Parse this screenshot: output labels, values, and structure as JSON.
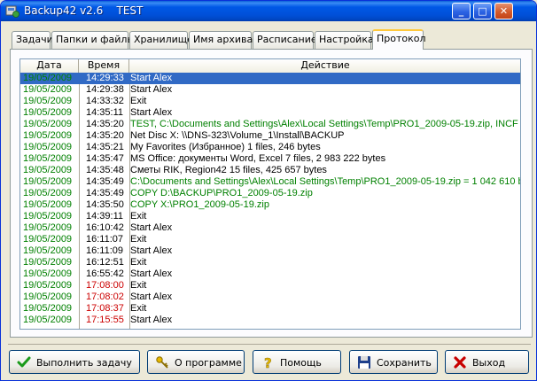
{
  "window": {
    "title": "Backup42 v2.6    TEST",
    "minimize": "_",
    "maximize": "□",
    "close": "✕"
  },
  "tabs": [
    {
      "label": "Задачи"
    },
    {
      "label": "Папки и файлы"
    },
    {
      "label": "Хранилище"
    },
    {
      "label": "Имя архива"
    },
    {
      "label": "Расписание"
    },
    {
      "label": "Настройка"
    },
    {
      "label": "Протокол"
    }
  ],
  "active_tab": "Протокол",
  "log": {
    "headers": {
      "date": "Дата",
      "time": "Время",
      "action": "Действие"
    },
    "rows": [
      {
        "date": "19/05/2009",
        "time": "14:29:33",
        "action": "Start Alex",
        "color": "#000000",
        "selected": true
      },
      {
        "date": "19/05/2009",
        "time": "14:29:38",
        "action": "Start Alex",
        "color": "#000000"
      },
      {
        "date": "19/05/2009",
        "time": "14:33:32",
        "action": "Exit",
        "color": "#000000"
      },
      {
        "date": "19/05/2009",
        "time": "14:35:11",
        "action": "Start Alex",
        "color": "#000000"
      },
      {
        "date": "19/05/2009",
        "time": "14:35:20",
        "action": "TEST,  C:\\Documents and Settings\\Alex\\Local Settings\\Temp\\PRO1_2009-05-19.zip,  INCF",
        "color": "#008000"
      },
      {
        "date": "19/05/2009",
        "time": "14:35:20",
        "action": "Net Disc X:  \\\\DNS-323\\Volume_1\\Install\\BACKUP",
        "color": "#000000"
      },
      {
        "date": "19/05/2009",
        "time": "14:35:21",
        "action": "My Favorites (Избранное)  1 files, 246 bytes",
        "color": "#000000"
      },
      {
        "date": "19/05/2009",
        "time": "14:35:47",
        "action": "MS Office: документы Word, Excel  7 files, 2 983 222 bytes",
        "color": "#000000"
      },
      {
        "date": "19/05/2009",
        "time": "14:35:48",
        "action": "Сметы RIK, Region42  15 files, 425 657 bytes",
        "color": "#000000"
      },
      {
        "date": "19/05/2009",
        "time": "14:35:49",
        "action": "C:\\Documents and Settings\\Alex\\Local Settings\\Temp\\PRO1_2009-05-19.zip = 1 042 610 by",
        "color": "#008000"
      },
      {
        "date": "19/05/2009",
        "time": "14:35:49",
        "action": "COPY D:\\BACKUP\\PRO1_2009-05-19.zip",
        "color": "#008000"
      },
      {
        "date": "19/05/2009",
        "time": "14:35:50",
        "action": "COPY X:\\PRO1_2009-05-19.zip",
        "color": "#008000"
      },
      {
        "date": "19/05/2009",
        "time": "14:39:11",
        "action": "Exit",
        "color": "#000000"
      },
      {
        "date": "19/05/2009",
        "time": "16:10:42",
        "action": "Start Alex",
        "color": "#000000"
      },
      {
        "date": "19/05/2009",
        "time": "16:11:07",
        "action": "Exit",
        "color": "#000000"
      },
      {
        "date": "19/05/2009",
        "time": "16:11:09",
        "action": "Start Alex",
        "color": "#000000"
      },
      {
        "date": "19/05/2009",
        "time": "16:12:51",
        "action": "Exit",
        "color": "#000000"
      },
      {
        "date": "19/05/2009",
        "time": "16:55:42",
        "action": "Start Alex",
        "color": "#000000"
      },
      {
        "date": "19/05/2009",
        "time": "17:08:00",
        "action": "Exit",
        "color": "#000000",
        "time_color": "#cc0000"
      },
      {
        "date": "19/05/2009",
        "time": "17:08:02",
        "action": "Start Alex",
        "color": "#000000",
        "time_color": "#cc0000"
      },
      {
        "date": "19/05/2009",
        "time": "17:08:37",
        "action": "Exit",
        "color": "#000000",
        "time_color": "#cc0000"
      },
      {
        "date": "19/05/2009",
        "time": "17:15:55",
        "action": "Start Alex",
        "color": "#000000",
        "time_color": "#cc0000"
      }
    ],
    "date_color": "#008000",
    "time_color": "#000000"
  },
  "buttons": {
    "run": {
      "label": "Выполнить задачу",
      "icon": "checkmark-icon"
    },
    "about": {
      "label": "О программе",
      "icon": "keys-icon"
    },
    "help": {
      "label": "Помощь",
      "icon": "question-icon"
    },
    "save": {
      "label": "Сохранить",
      "icon": "floppy-icon"
    },
    "exit": {
      "label": "Выход",
      "icon": "red-x-icon"
    }
  },
  "colors": {
    "selection": "#316ac5",
    "green_text": "#008000",
    "red_text": "#cc0000"
  }
}
